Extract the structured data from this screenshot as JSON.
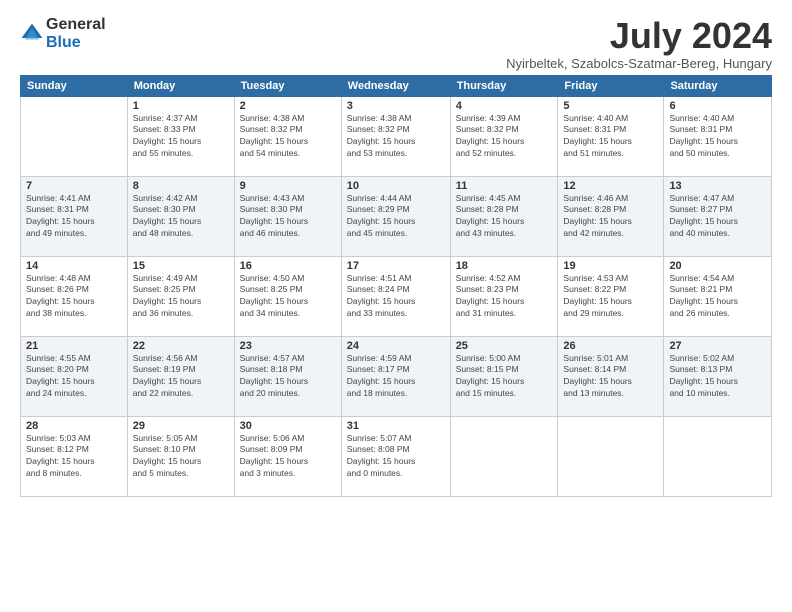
{
  "logo": {
    "general": "General",
    "blue": "Blue"
  },
  "title": "July 2024",
  "location": "Nyirbeltek, Szabolcs-Szatmar-Bereg, Hungary",
  "weekdays": [
    "Sunday",
    "Monday",
    "Tuesday",
    "Wednesday",
    "Thursday",
    "Friday",
    "Saturday"
  ],
  "weeks": [
    [
      {
        "day": "",
        "info": ""
      },
      {
        "day": "1",
        "info": "Sunrise: 4:37 AM\nSunset: 8:33 PM\nDaylight: 15 hours\nand 55 minutes."
      },
      {
        "day": "2",
        "info": "Sunrise: 4:38 AM\nSunset: 8:32 PM\nDaylight: 15 hours\nand 54 minutes."
      },
      {
        "day": "3",
        "info": "Sunrise: 4:38 AM\nSunset: 8:32 PM\nDaylight: 15 hours\nand 53 minutes."
      },
      {
        "day": "4",
        "info": "Sunrise: 4:39 AM\nSunset: 8:32 PM\nDaylight: 15 hours\nand 52 minutes."
      },
      {
        "day": "5",
        "info": "Sunrise: 4:40 AM\nSunset: 8:31 PM\nDaylight: 15 hours\nand 51 minutes."
      },
      {
        "day": "6",
        "info": "Sunrise: 4:40 AM\nSunset: 8:31 PM\nDaylight: 15 hours\nand 50 minutes."
      }
    ],
    [
      {
        "day": "7",
        "info": "Sunrise: 4:41 AM\nSunset: 8:31 PM\nDaylight: 15 hours\nand 49 minutes."
      },
      {
        "day": "8",
        "info": "Sunrise: 4:42 AM\nSunset: 8:30 PM\nDaylight: 15 hours\nand 48 minutes."
      },
      {
        "day": "9",
        "info": "Sunrise: 4:43 AM\nSunset: 8:30 PM\nDaylight: 15 hours\nand 46 minutes."
      },
      {
        "day": "10",
        "info": "Sunrise: 4:44 AM\nSunset: 8:29 PM\nDaylight: 15 hours\nand 45 minutes."
      },
      {
        "day": "11",
        "info": "Sunrise: 4:45 AM\nSunset: 8:28 PM\nDaylight: 15 hours\nand 43 minutes."
      },
      {
        "day": "12",
        "info": "Sunrise: 4:46 AM\nSunset: 8:28 PM\nDaylight: 15 hours\nand 42 minutes."
      },
      {
        "day": "13",
        "info": "Sunrise: 4:47 AM\nSunset: 8:27 PM\nDaylight: 15 hours\nand 40 minutes."
      }
    ],
    [
      {
        "day": "14",
        "info": "Sunrise: 4:48 AM\nSunset: 8:26 PM\nDaylight: 15 hours\nand 38 minutes."
      },
      {
        "day": "15",
        "info": "Sunrise: 4:49 AM\nSunset: 8:25 PM\nDaylight: 15 hours\nand 36 minutes."
      },
      {
        "day": "16",
        "info": "Sunrise: 4:50 AM\nSunset: 8:25 PM\nDaylight: 15 hours\nand 34 minutes."
      },
      {
        "day": "17",
        "info": "Sunrise: 4:51 AM\nSunset: 8:24 PM\nDaylight: 15 hours\nand 33 minutes."
      },
      {
        "day": "18",
        "info": "Sunrise: 4:52 AM\nSunset: 8:23 PM\nDaylight: 15 hours\nand 31 minutes."
      },
      {
        "day": "19",
        "info": "Sunrise: 4:53 AM\nSunset: 8:22 PM\nDaylight: 15 hours\nand 29 minutes."
      },
      {
        "day": "20",
        "info": "Sunrise: 4:54 AM\nSunset: 8:21 PM\nDaylight: 15 hours\nand 26 minutes."
      }
    ],
    [
      {
        "day": "21",
        "info": "Sunrise: 4:55 AM\nSunset: 8:20 PM\nDaylight: 15 hours\nand 24 minutes."
      },
      {
        "day": "22",
        "info": "Sunrise: 4:56 AM\nSunset: 8:19 PM\nDaylight: 15 hours\nand 22 minutes."
      },
      {
        "day": "23",
        "info": "Sunrise: 4:57 AM\nSunset: 8:18 PM\nDaylight: 15 hours\nand 20 minutes."
      },
      {
        "day": "24",
        "info": "Sunrise: 4:59 AM\nSunset: 8:17 PM\nDaylight: 15 hours\nand 18 minutes."
      },
      {
        "day": "25",
        "info": "Sunrise: 5:00 AM\nSunset: 8:15 PM\nDaylight: 15 hours\nand 15 minutes."
      },
      {
        "day": "26",
        "info": "Sunrise: 5:01 AM\nSunset: 8:14 PM\nDaylight: 15 hours\nand 13 minutes."
      },
      {
        "day": "27",
        "info": "Sunrise: 5:02 AM\nSunset: 8:13 PM\nDaylight: 15 hours\nand 10 minutes."
      }
    ],
    [
      {
        "day": "28",
        "info": "Sunrise: 5:03 AM\nSunset: 8:12 PM\nDaylight: 15 hours\nand 8 minutes."
      },
      {
        "day": "29",
        "info": "Sunrise: 5:05 AM\nSunset: 8:10 PM\nDaylight: 15 hours\nand 5 minutes."
      },
      {
        "day": "30",
        "info": "Sunrise: 5:06 AM\nSunset: 8:09 PM\nDaylight: 15 hours\nand 3 minutes."
      },
      {
        "day": "31",
        "info": "Sunrise: 5:07 AM\nSunset: 8:08 PM\nDaylight: 15 hours\nand 0 minutes."
      },
      {
        "day": "",
        "info": ""
      },
      {
        "day": "",
        "info": ""
      },
      {
        "day": "",
        "info": ""
      }
    ]
  ]
}
